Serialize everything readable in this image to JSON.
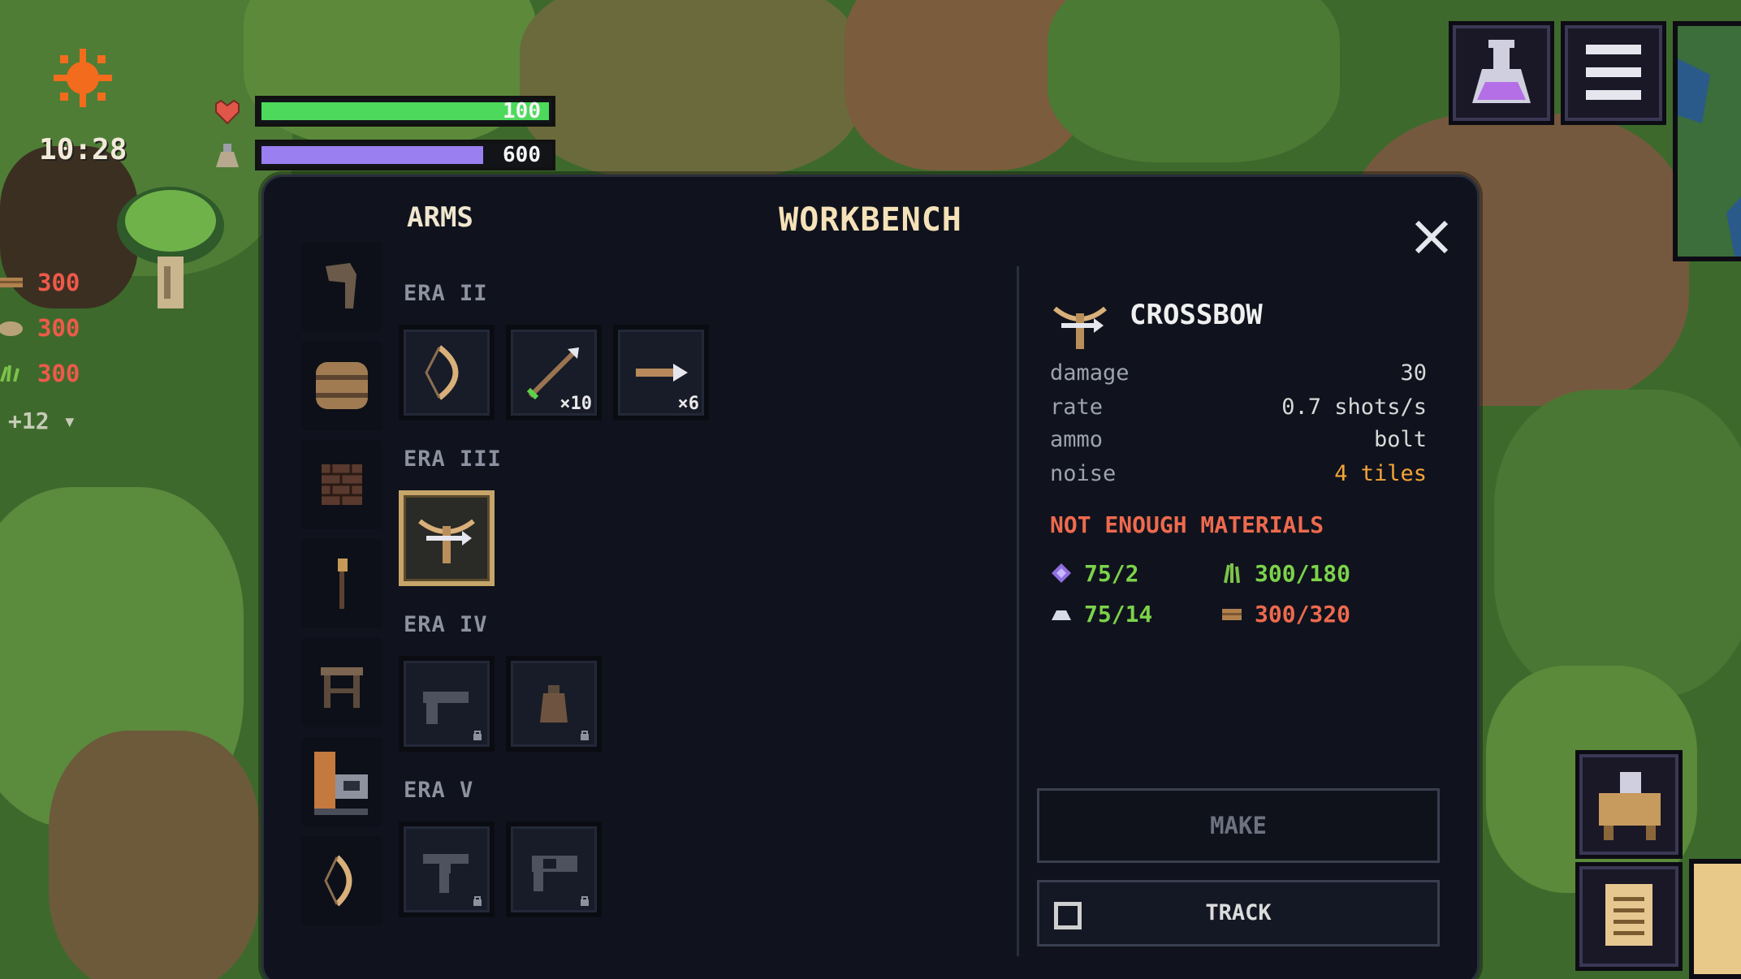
{
  "hud": {
    "time": "10:28",
    "health": {
      "value": "100",
      "fill": 1.0,
      "color": "#4dd95c",
      "icon": "heart-icon"
    },
    "energy": {
      "value": "600",
      "fill": 0.77,
      "color": "#9a7ff0",
      "icon": "flask-icon"
    },
    "resources": [
      {
        "icon": "wood-log-icon",
        "value": "300"
      },
      {
        "icon": "stone-icon",
        "value": "300"
      },
      {
        "icon": "fiber-icon",
        "value": "300"
      }
    ],
    "more_resources": "+12 ▾",
    "corner_buttons": [
      "potion-icon",
      "menu-icon",
      "minimap",
      "workbench-icon",
      "notes-icon",
      "map-icon"
    ]
  },
  "workbench": {
    "category_title": "ARMS",
    "title": "WORKBENCH",
    "sidebar_icons": [
      "weapon-category-icon",
      "barrel-icon",
      "brick-wall-icon",
      "torch-icon",
      "table-icon",
      "machine-icon",
      "bow-icon"
    ],
    "eras": [
      {
        "label": "ERA II",
        "items": [
          {
            "icon": "bow-icon",
            "count": "",
            "locked": false,
            "selected": false
          },
          {
            "icon": "spear-icon",
            "count": "×10",
            "locked": false,
            "selected": false
          },
          {
            "icon": "bolt-icon",
            "count": "×6",
            "locked": false,
            "selected": false
          }
        ]
      },
      {
        "label": "ERA III",
        "items": [
          {
            "icon": "crossbow-icon",
            "count": "",
            "locked": false,
            "selected": true
          }
        ]
      },
      {
        "label": "ERA IV",
        "items": [
          {
            "icon": "pistol-icon",
            "count": "",
            "locked": true,
            "selected": false
          },
          {
            "icon": "pouch-icon",
            "count": "",
            "locked": true,
            "selected": false
          }
        ]
      },
      {
        "label": "ERA V",
        "items": [
          {
            "icon": "revolver-icon",
            "count": "",
            "locked": true,
            "selected": false
          },
          {
            "icon": "rifle-icon",
            "count": "",
            "locked": true,
            "selected": false
          }
        ]
      }
    ],
    "selected_item": {
      "name": "CROSSBOW",
      "icon": "crossbow-icon",
      "stats": [
        {
          "key": "damage",
          "value": "30",
          "warn": false
        },
        {
          "key": "rate",
          "value": "0.7 shots/s",
          "warn": false
        },
        {
          "key": "ammo",
          "value": "bolt",
          "warn": false
        },
        {
          "key": "noise",
          "value": "4 tiles",
          "warn": true
        }
      ],
      "warning": "NOT ENOUGH MATERIALS",
      "materials": [
        {
          "icon": "crystal-icon",
          "amount": "75/2",
          "enough": true
        },
        {
          "icon": "fiber-icon",
          "amount": "300/180",
          "enough": true
        },
        {
          "icon": "metal-icon",
          "amount": "75/14",
          "enough": true
        },
        {
          "icon": "wood-plank-icon",
          "amount": "300/320",
          "enough": false
        }
      ]
    },
    "make_label": "MAKE",
    "track_label": "TRACK"
  }
}
